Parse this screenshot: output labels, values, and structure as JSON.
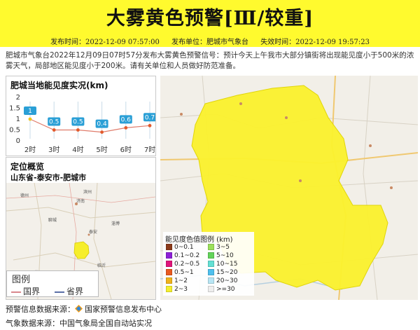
{
  "header": {
    "title": "大雾黄色预警[Ⅲ/较重]",
    "publish_time": "发布时间：2022-12-09 07:57:00",
    "publisher": "发布单位：肥城市气象台",
    "expire_time": "失效时间：2022-12-09 19:57:23"
  },
  "description": "肥城市气象台2022年12月09日07时57分发布大雾黄色预警信号：预计今天上午我市大部分镇街将出现能见度小于500米的浓雾天气，局部地区能见度小于200米。请有关单位和人员做好防范准备。",
  "visibility_panel": {
    "title": "肥城当地能见度实况(km)"
  },
  "chart_data": {
    "type": "line",
    "title": "肥城当地能见度实况(km)",
    "categories": [
      "2时",
      "3时",
      "4时",
      "5时",
      "6时",
      "7时"
    ],
    "values": [
      1,
      0.5,
      0.5,
      0.4,
      0.6,
      0.7
    ],
    "value_labels": [
      "1",
      "0.5",
      "0.5",
      "0.4",
      "0.6",
      "0.7"
    ],
    "y_ticks": [
      "0",
      "0.5",
      "1",
      "1.5",
      "2"
    ],
    "ylim": [
      0,
      2
    ],
    "grid": false,
    "line_color": "#e07b6a",
    "label_color": "#2a9fd6",
    "point_colors": [
      "#f0c419",
      "#e25a2c",
      "#e25a2c",
      "#e25a2c",
      "#e25a2c",
      "#e25a2c"
    ]
  },
  "location_panel": {
    "title": "定位概览",
    "location": "山东省-泰安市-肥城市",
    "map_legend": {
      "title": "图例",
      "national_border": "国界",
      "provincial_border": "省界"
    }
  },
  "visibility_legend": {
    "title": "能见度色值图例 (km)",
    "items": [
      {
        "label": "0~0.1",
        "color": "#8b3a1a"
      },
      {
        "label": "3~5",
        "color": "#9be05b"
      },
      {
        "label": "0.1~0.2",
        "color": "#8c1fd6"
      },
      {
        "label": "5~10",
        "color": "#62d35a"
      },
      {
        "label": "0.2~0.5",
        "color": "#e0147a"
      },
      {
        "label": "10~15",
        "color": "#63e0d4"
      },
      {
        "label": "0.5~1",
        "color": "#e8591f"
      },
      {
        "label": "15~20",
        "color": "#4ec0ee"
      },
      {
        "label": "1~2",
        "color": "#f0b31a"
      },
      {
        "label": "20~30",
        "color": "#b8e5f4"
      },
      {
        "label": "2~3",
        "color": "#f4ef2e"
      },
      {
        "label": ">=30",
        "color": "#eeeeee"
      }
    ]
  },
  "footer": {
    "source1": "预警信息数据来源：",
    "source1_name": "国家预警信息发布中心",
    "source2": "气象数据来源：中国气象局全国自动站实况"
  }
}
